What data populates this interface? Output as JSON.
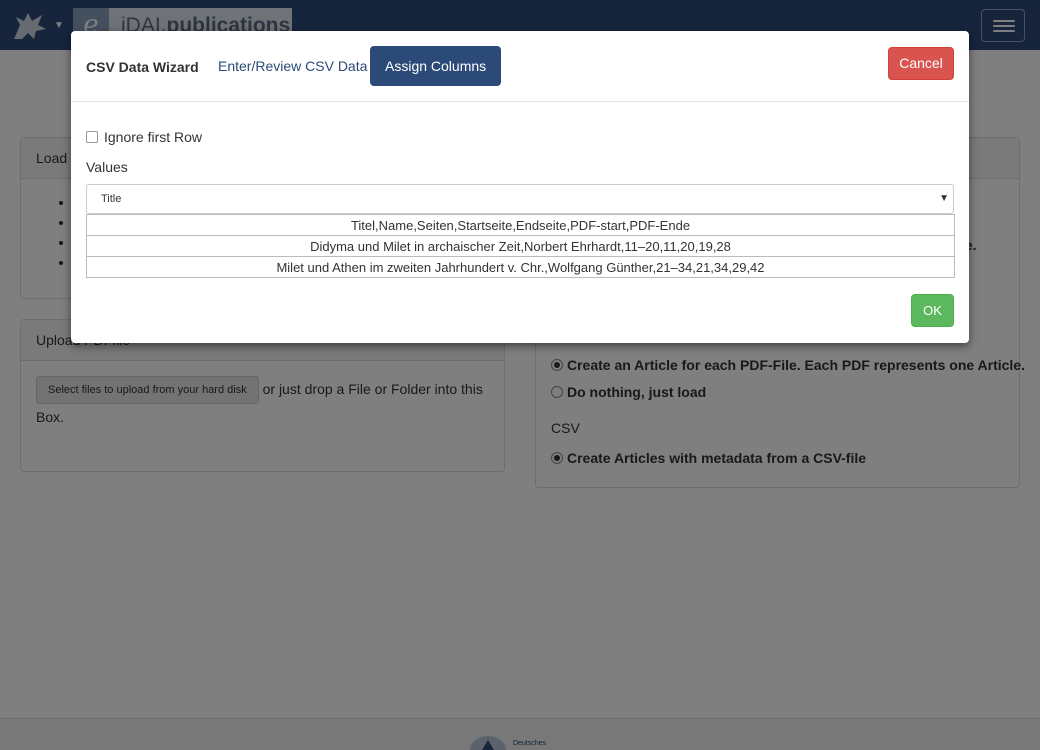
{
  "navbar": {
    "brand_prefix": "iDAI.",
    "brand_name": "publications"
  },
  "left_panels": {
    "load_title": "Load f",
    "load_items": [
      "",
      "",
      "",
      ""
    ],
    "upload_title": "Upload PDFfile",
    "upload_button": "Select files to upload from your hard disk",
    "upload_hint": "or just drop a File or Folder into this Box."
  },
  "right_panel": {
    "clipped_text": "le.",
    "pdf_option_article": "Create an Article for each PDF-File. Each PDF represents one Article.",
    "pdf_option_nothing": "Do nothing, just load",
    "csv_label": "CSV",
    "csv_option": "Create Articles with metadata from a CSV-file"
  },
  "footer": {
    "logo_text": "Deutsches"
  },
  "modal": {
    "title": "CSV Data Wizard",
    "tab_enter": "Enter/Review CSV Data",
    "tab_assign": "Assign Columns",
    "cancel": "Cancel",
    "ignore_first_row": "Ignore first Row",
    "values_label": "Values",
    "selected_column": "Title",
    "rows": [
      "Titel,Name,Seiten,Startseite,Endseite,PDF-start,PDF-Ende",
      "Didyma und Milet in archaischer Zeit,Norbert Ehrhardt,11–20,11,20,19,28",
      "Milet und Athen im zweiten Jahrhundert v. Chr.,Wolfgang Günther,21–34,21,34,29,42"
    ],
    "ok": "OK"
  },
  "colors": {
    "navbar": "#2c4a78",
    "primary": "#2c4a78",
    "danger": "#d9534f",
    "success": "#5cb85c"
  },
  "icons": [
    "griffin-logo-icon",
    "caret-down-icon",
    "hamburger-menu-icon",
    "dropdown-arrow-icon"
  ]
}
